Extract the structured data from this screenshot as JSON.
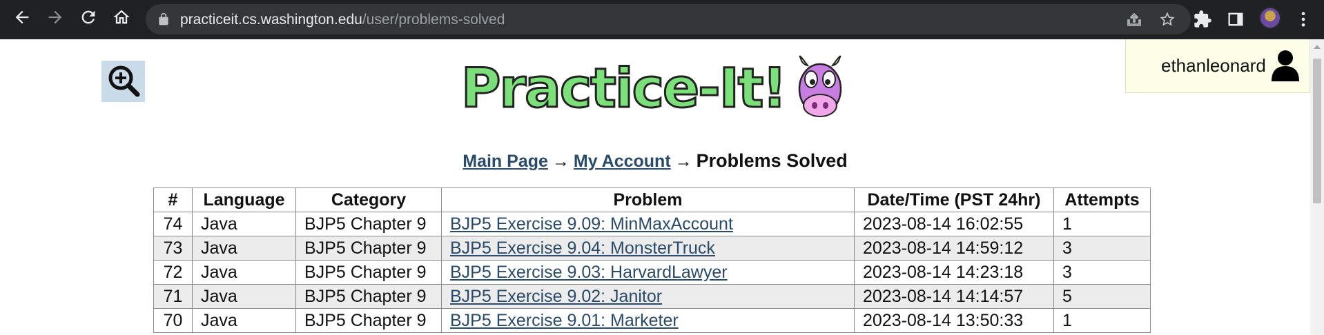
{
  "browser": {
    "url_host": "practiceit.cs.washington.edu",
    "url_path": "/user/problems-solved"
  },
  "header": {
    "logo_text": "Practice-It!",
    "username": "ethanleonard"
  },
  "breadcrumb": {
    "main_page": "Main Page",
    "arrow": "→",
    "my_account": "My Account",
    "current": "Problems Solved"
  },
  "table": {
    "headers": [
      "#",
      "Language",
      "Category",
      "Problem",
      "Date/Time (PST 24hr)",
      "Attempts"
    ],
    "rows": [
      {
        "num": "74",
        "language": "Java",
        "category": "BJP5 Chapter 9",
        "problem": "BJP5 Exercise 9.09: MinMaxAccount",
        "datetime": "2023-08-14 16:02:55",
        "attempts": "1"
      },
      {
        "num": "73",
        "language": "Java",
        "category": "BJP5 Chapter 9",
        "problem": "BJP5 Exercise 9.04: MonsterTruck",
        "datetime": "2023-08-14 14:59:12",
        "attempts": "3"
      },
      {
        "num": "72",
        "language": "Java",
        "category": "BJP5 Chapter 9",
        "problem": "BJP5 Exercise 9.03: HarvardLawyer",
        "datetime": "2023-08-14 14:23:18",
        "attempts": "3"
      },
      {
        "num": "71",
        "language": "Java",
        "category": "BJP5 Chapter 9",
        "problem": "BJP5 Exercise 9.02: Janitor",
        "datetime": "2023-08-14 14:14:57",
        "attempts": "5"
      },
      {
        "num": "70",
        "language": "Java",
        "category": "BJP5 Chapter 9",
        "problem": "BJP5 Exercise 9.01: Marketer",
        "datetime": "2023-08-14 13:50:33",
        "attempts": "1"
      }
    ]
  },
  "icons": {
    "back": "arrow-left-icon",
    "forward": "arrow-right-icon",
    "reload": "reload-icon",
    "home": "home-icon",
    "lock": "lock-icon",
    "share": "share-icon",
    "bookmark": "star-icon",
    "extensions": "puzzle-icon",
    "side_panel": "side-panel-icon",
    "menu": "kebab-menu-icon",
    "zoom": "zoom-in-icon",
    "user": "user-icon"
  },
  "colors": {
    "chrome_bg": "#202124",
    "omnibox_bg": "#35363a",
    "link": "#2a4a6a",
    "alt_row": "#ececec",
    "user_box_bg": "#fdfde8",
    "zoom_btn_bg": "#c9dbe8",
    "logo_green": "#7be07a",
    "cow_purple": "#c77ee0"
  }
}
